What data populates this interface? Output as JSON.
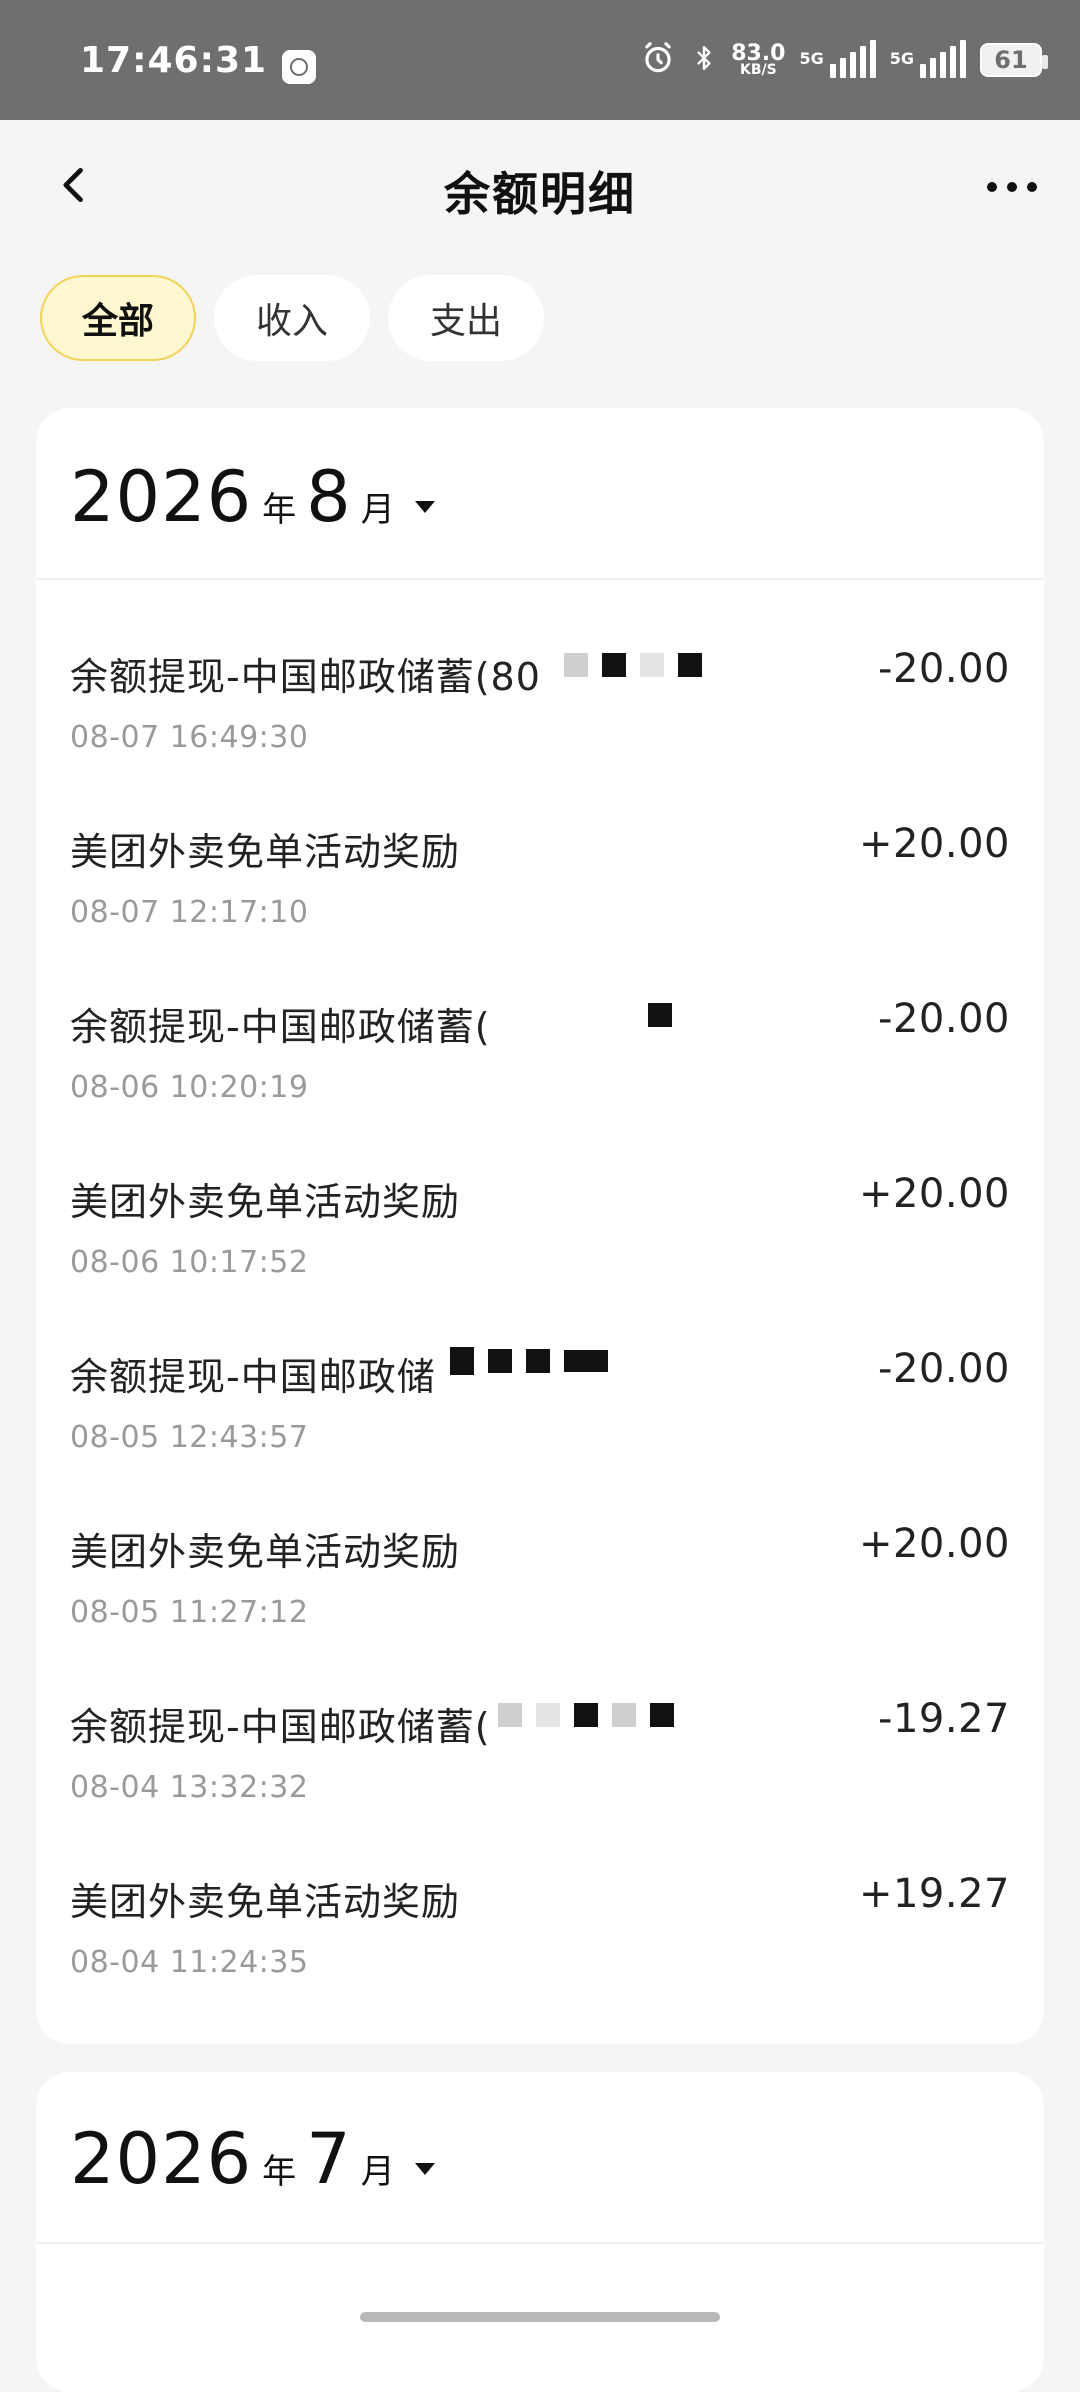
{
  "status_bar": {
    "time": "17:46:31",
    "net_speed_value": "83.0",
    "net_speed_unit": "KB/S",
    "network_1": "5G",
    "network_2": "5G",
    "battery": "61"
  },
  "header": {
    "title": "余额明细"
  },
  "filters": [
    {
      "label": "全部",
      "active": true
    },
    {
      "label": "收入",
      "active": false
    },
    {
      "label": "支出",
      "active": false
    }
  ],
  "months": [
    {
      "year": "2026",
      "year_suffix": "年",
      "month": "8",
      "month_suffix": "月",
      "items": [
        {
          "title": "余额提现-中国邮政储蓄(80",
          "time": "08-07 16:49:30",
          "amount": "-20.00"
        },
        {
          "title": "美团外卖免单活动奖励",
          "time": "08-07 12:17:10",
          "amount": "+20.00"
        },
        {
          "title": "余额提现-中国邮政储蓄(",
          "time": "08-06 10:20:19",
          "amount": "-20.00"
        },
        {
          "title": "美团外卖免单活动奖励",
          "time": "08-06 10:17:52",
          "amount": "+20.00"
        },
        {
          "title": "余额提现-中国邮政储",
          "time": "08-05 12:43:57",
          "amount": "-20.00"
        },
        {
          "title": "美团外卖免单活动奖励",
          "time": "08-05 11:27:12",
          "amount": "+20.00"
        },
        {
          "title": "余额提现-中国邮政储蓄(",
          "time": "08-04 13:32:32",
          "amount": "-19.27"
        },
        {
          "title": "美团外卖免单活动奖励",
          "time": "08-04 11:24:35",
          "amount": "+19.27"
        }
      ]
    },
    {
      "year": "2026",
      "year_suffix": "年",
      "month": "7",
      "month_suffix": "月",
      "items": []
    }
  ]
}
